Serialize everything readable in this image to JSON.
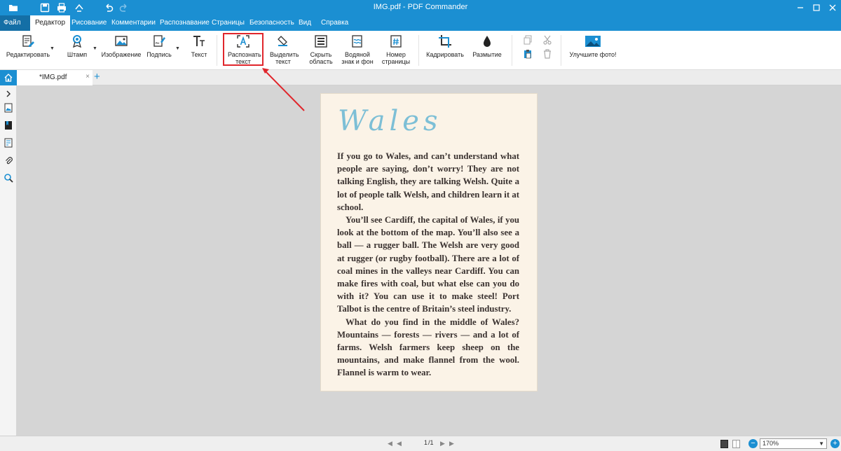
{
  "window": {
    "title": "IMG.pdf - PDF Commander"
  },
  "menubar": {
    "file": "Файл",
    "tabs": [
      "Редактор",
      "Рисование",
      "Комментарии",
      "Распознавание",
      "Страницы",
      "Безопасность",
      "Вид",
      "Справка"
    ],
    "active_tab": "Редактор"
  },
  "ribbon": {
    "buttons": [
      {
        "label": "Редактировать",
        "icon": "edit-document-icon"
      },
      {
        "label": "Штамп",
        "icon": "stamp-icon"
      },
      {
        "label": "Изображение",
        "icon": "image-icon"
      },
      {
        "label": "Подпись",
        "icon": "signature-icon"
      },
      {
        "label": "Текст",
        "icon": "text-icon"
      },
      {
        "label": "Распознать текст",
        "icon": "ocr-icon"
      },
      {
        "label": "Выделить текст",
        "icon": "highlighter-icon"
      },
      {
        "label": "Скрыть область",
        "icon": "hide-area-icon"
      },
      {
        "label": "Водяной знак и фон",
        "icon": "watermark-icon"
      },
      {
        "label": "Номер страницы",
        "icon": "page-number-icon"
      },
      {
        "label": "Кадрировать",
        "icon": "crop-icon"
      },
      {
        "label": "Размытие",
        "icon": "blur-icon"
      },
      {
        "label": "Улучшите фото!",
        "icon": "enhance-photo-icon"
      }
    ]
  },
  "tabs": {
    "document_tab": "*IMG.pdf",
    "close": "×",
    "add": "+"
  },
  "document": {
    "heading": "Wales",
    "paragraphs": [
      "If you go to Wales, and can’t understand what people are saying, don’t worry! They are not talking English, they are talking Welsh. Quite a lot of people talk Welsh, and children learn it at school.",
      "You’ll see Cardiff, the capital of Wales, if you look at the bottom of the map. You’ll also see a ball — a rugger ball. The Welsh are very good at rugger (or rugby football). There are a lot of coal mines in the valleys near Cardiff. You can make fires with coal, but what else can you do with it? You can use it to make steel! Port Talbot is the centre of Britain’s steel industry.",
      "What do you find in the middle of Wales? Mountains — forests — rivers — and a lot of farms. Welsh farmers keep sheep on the mountains, and make flannel from the wool. Flannel is warm to wear."
    ]
  },
  "statusbar": {
    "page_current": "1",
    "page_total": "/1",
    "zoom": "170%"
  },
  "colors": {
    "accent": "#1b8fd2",
    "highlight_box": "#e0262c",
    "heading_color": "#7dbfd6"
  }
}
